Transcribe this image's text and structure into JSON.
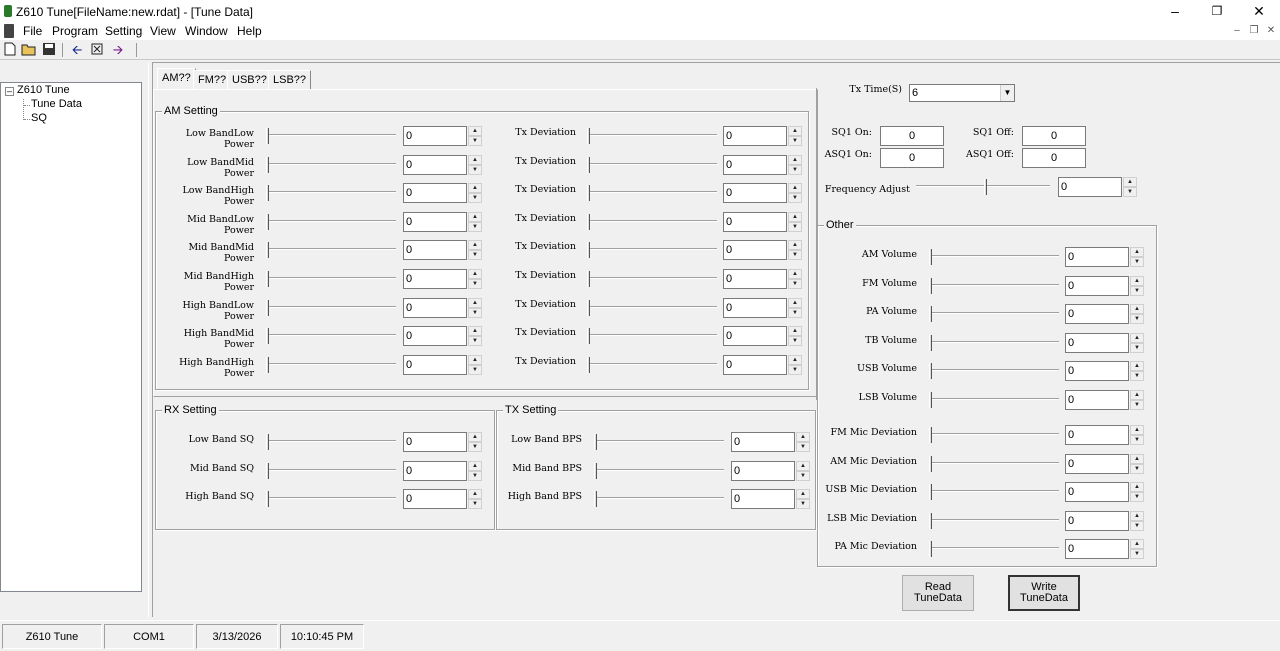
{
  "window": {
    "title": "Z610 Tune[FileName:new.rdat] - [Tune Data]"
  },
  "menu": [
    "File",
    "Program",
    "Setting",
    "View",
    "Window",
    "Help"
  ],
  "toolbar": [
    "new-file-icon",
    "open-folder-icon",
    "save-icon",
    "arrow-left-icon",
    "program-icon",
    "arrow-right-icon"
  ],
  "tree": {
    "root": "Z610 Tune",
    "children": [
      "Tune Data",
      "SQ"
    ]
  },
  "tabs": [
    "AM??",
    "FM??",
    "USB??",
    "LSB??"
  ],
  "am_setting": {
    "title": "AM Setting",
    "rows": [
      {
        "power_label": "Low BandLow Power",
        "power_value": "0",
        "dev_label": "Tx Deviation",
        "dev_value": "0"
      },
      {
        "power_label": "Low BandMid Power",
        "power_value": "0",
        "dev_label": "Tx Deviation",
        "dev_value": "0"
      },
      {
        "power_label": "Low BandHigh Power",
        "power_value": "0",
        "dev_label": "Tx Deviation",
        "dev_value": "0"
      },
      {
        "power_label": "Mid BandLow Power",
        "power_value": "0",
        "dev_label": "Tx Deviation",
        "dev_value": "0"
      },
      {
        "power_label": "Mid BandMid Power",
        "power_value": "0",
        "dev_label": "Tx Deviation",
        "dev_value": "0"
      },
      {
        "power_label": "Mid BandHigh Power",
        "power_value": "0",
        "dev_label": "Tx Deviation",
        "dev_value": "0"
      },
      {
        "power_label": "High BandLow Power",
        "power_value": "0",
        "dev_label": "Tx Deviation",
        "dev_value": "0"
      },
      {
        "power_label": "High BandMid Power",
        "power_value": "0",
        "dev_label": "Tx Deviation",
        "dev_value": "0"
      },
      {
        "power_label": "High BandHigh Power",
        "power_value": "0",
        "dev_label": "Tx Deviation",
        "dev_value": "0"
      }
    ]
  },
  "rx_setting": {
    "title": "RX Setting",
    "rows": [
      {
        "label": "Low Band SQ",
        "value": "0"
      },
      {
        "label": "Mid Band SQ",
        "value": "0"
      },
      {
        "label": "High Band SQ",
        "value": "0"
      }
    ]
  },
  "tx_setting": {
    "title": "TX Setting",
    "rows": [
      {
        "label": "Low Band BPS",
        "value": "0"
      },
      {
        "label": "Mid Band BPS",
        "value": "0"
      },
      {
        "label": "High Band BPS",
        "value": "0"
      }
    ]
  },
  "tx_time": {
    "label": "Tx Time(S)",
    "value": "6"
  },
  "sq": {
    "sq1_on_label": "SQ1 On:",
    "sq1_on_value": "0",
    "sq1_off_label": "SQ1 Off:",
    "sq1_off_value": "0",
    "asq1_on_label": "ASQ1 On:",
    "asq1_on_value": "0",
    "asq1_off_label": "ASQ1 Off:",
    "asq1_off_value": "0"
  },
  "freq_adjust": {
    "label": "Frequency Adjust",
    "value": "0"
  },
  "other": {
    "title": "Other",
    "rows": [
      {
        "label": "AM Volume",
        "value": "0"
      },
      {
        "label": "FM Volume",
        "value": "0"
      },
      {
        "label": "PA Volume",
        "value": "0"
      },
      {
        "label": "TB Volume",
        "value": "0"
      },
      {
        "label": "USB Volume",
        "value": "0"
      },
      {
        "label": "LSB Volume",
        "value": "0"
      },
      {
        "label": "FM Mic Deviation",
        "value": "0"
      },
      {
        "label": "AM Mic Deviation",
        "value": "0"
      },
      {
        "label": "USB Mic Deviation",
        "value": "0"
      },
      {
        "label": "LSB Mic Deviation",
        "value": "0"
      },
      {
        "label": "PA Mic Deviation",
        "value": "0"
      }
    ]
  },
  "buttons": {
    "read": "Read TuneData",
    "write": "Write TuneData"
  },
  "status": {
    "app": "Z610 Tune",
    "port": "COM1",
    "date": "3/13/2026",
    "time": "10:10:45 PM"
  }
}
